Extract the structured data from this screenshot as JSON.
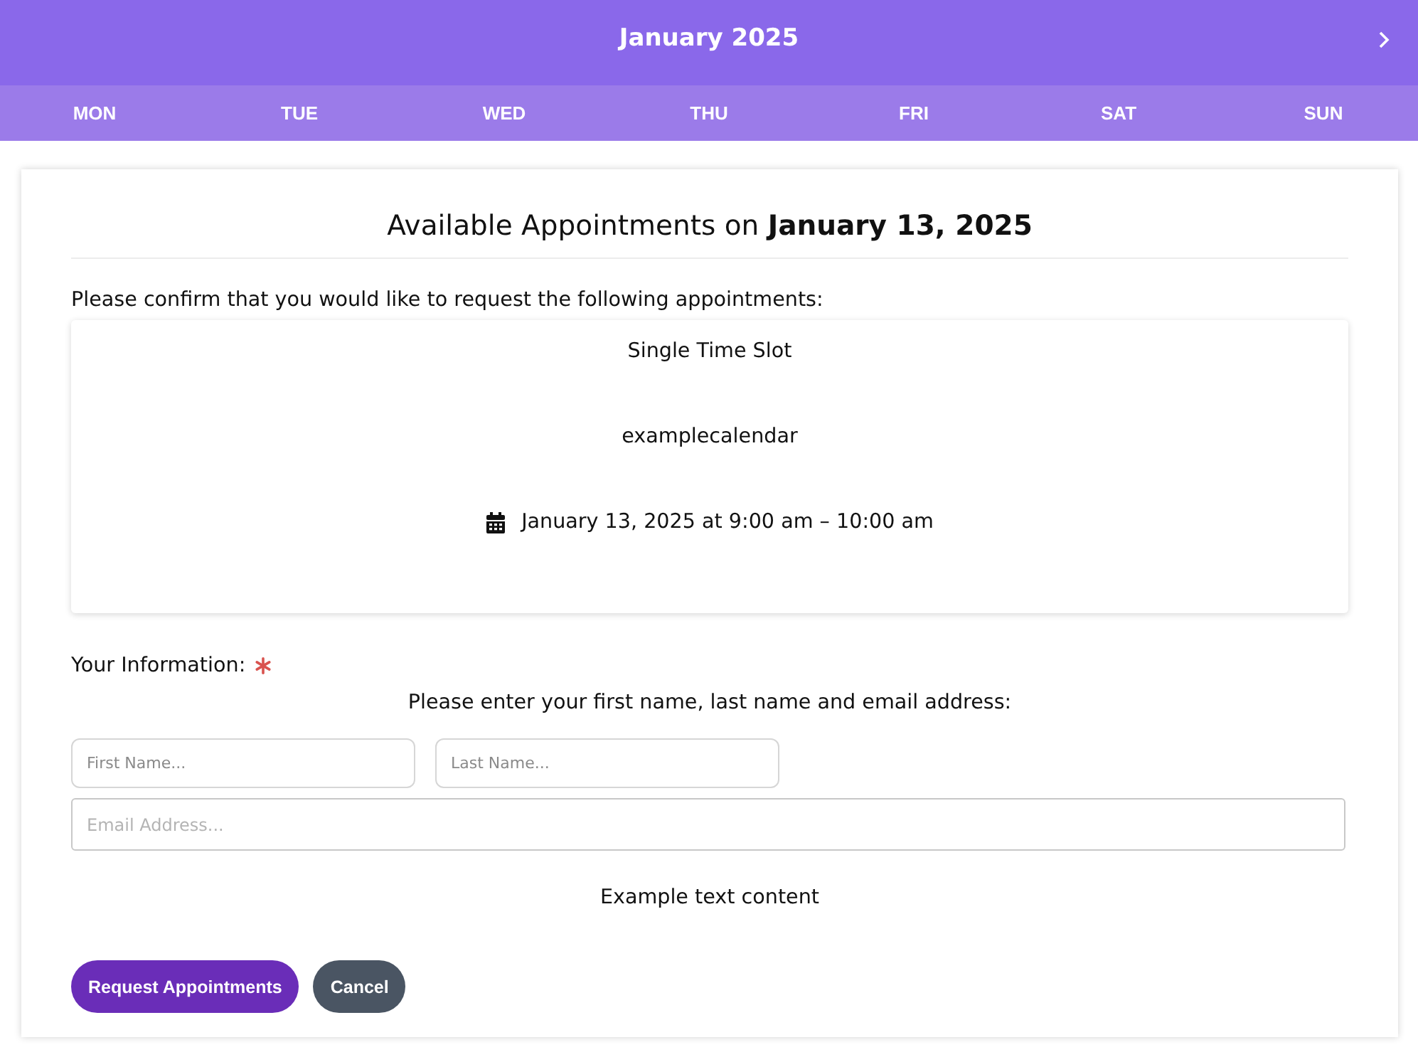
{
  "header": {
    "title": "January 2025"
  },
  "weekdays": [
    "MON",
    "TUE",
    "WED",
    "THU",
    "FRI",
    "SAT",
    "SUN"
  ],
  "dialog": {
    "title": "Available Appointments on **January 13, 2025**",
    "intro": "Please confirm that you would like to request the following appointments:",
    "appointment": {
      "type": "Single Time Slot",
      "calendar": "examplecalendar",
      "datetime": "January 13, 2025 at 9:00 am – 10:00 am"
    },
    "info_label": "Your Information:",
    "required": true,
    "instructions": "Please enter your first name, last name and email address:",
    "name_fields": [
      {
        "placeholder": "First Name..."
      },
      {
        "placeholder": "Last Name..."
      }
    ],
    "email_field": {
      "placeholder": "Email Address..."
    },
    "note": "Example text content",
    "buttons": [
      {
        "label": "Request Appointments",
        "kind": "primary"
      },
      {
        "label": "Cancel",
        "kind": "secondary"
      }
    ]
  }
}
